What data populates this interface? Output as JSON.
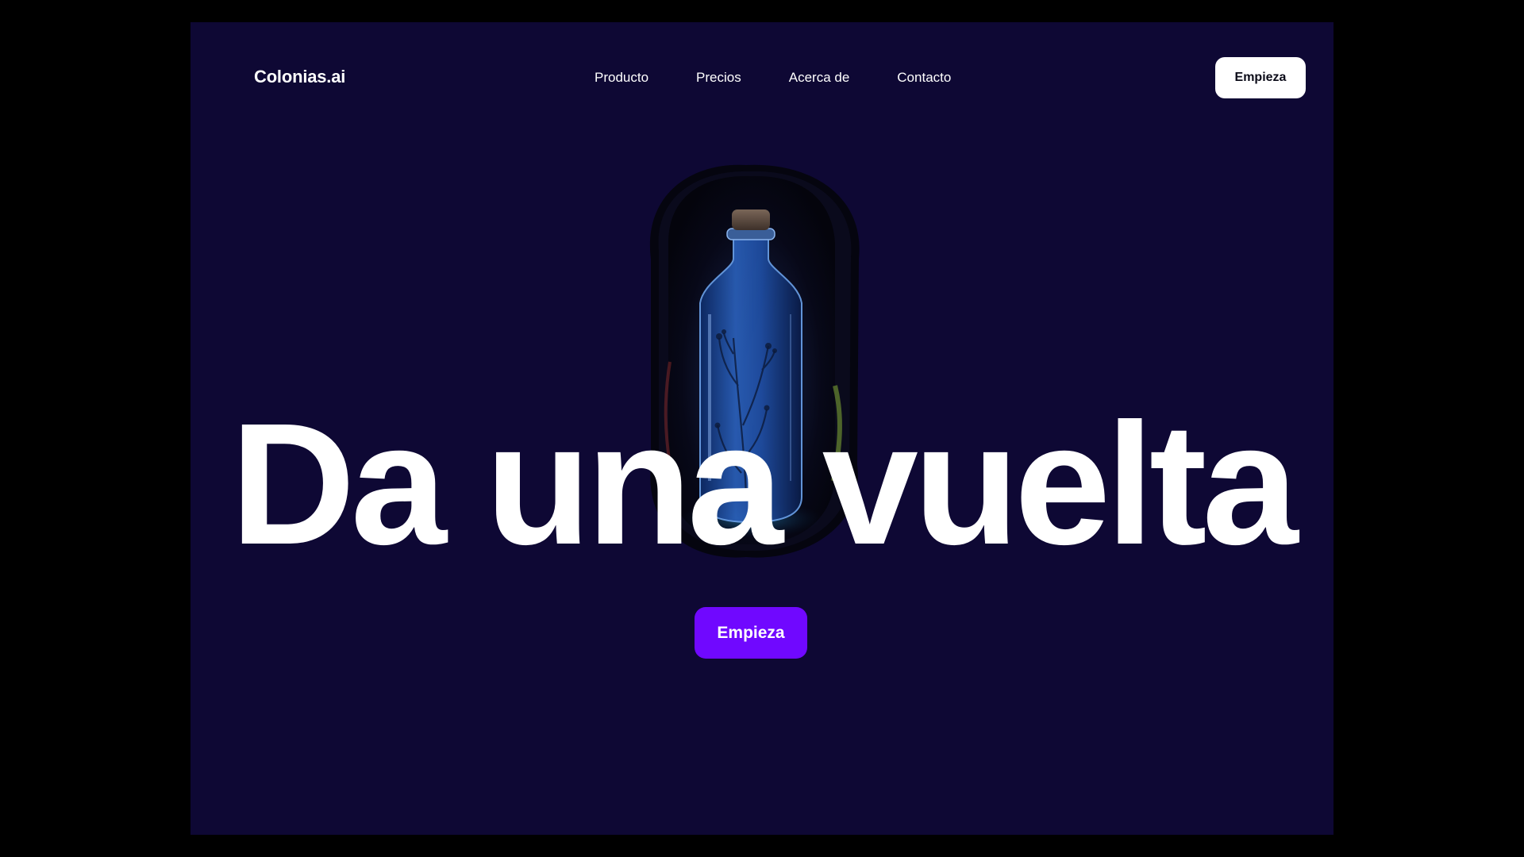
{
  "brand": {
    "name": "Colonias.ai"
  },
  "nav": {
    "links": [
      "Producto",
      "Precios",
      "Acerca de",
      "Contacto"
    ],
    "cta_label": "Empieza"
  },
  "hero": {
    "title": "Da una vuelta",
    "cta_label": "Empieza",
    "image": "blue-glass-bottle-with-botanical-etching"
  },
  "colors": {
    "background": "#0e0834",
    "outer": "#000000",
    "primary_cta": "#7008ff",
    "nav_cta": "#ffffff",
    "text": "#ffffff"
  }
}
